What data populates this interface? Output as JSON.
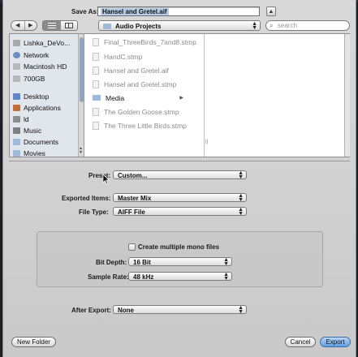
{
  "save_as": {
    "label": "Save As:",
    "value": "Hansel and Gretel.aif"
  },
  "location": {
    "current": "Audio Projects"
  },
  "search": {
    "placeholder": "search"
  },
  "sidebar": {
    "items": [
      {
        "label": "Lishka_DeVo...",
        "icon": "disk-icon"
      },
      {
        "label": "Network",
        "icon": "globe-icon"
      },
      {
        "label": "Macintosh HD",
        "icon": "hard-drive-icon"
      },
      {
        "label": "700GB",
        "icon": "hard-drive-icon"
      },
      {
        "label": "Desktop",
        "icon": "desktop-icon"
      },
      {
        "label": "Applications",
        "icon": "applications-icon"
      },
      {
        "label": "ld",
        "icon": "home-icon"
      },
      {
        "label": "Music",
        "icon": "music-icon"
      },
      {
        "label": "Documents",
        "icon": "documents-folder-icon"
      },
      {
        "label": "Movies",
        "icon": "movies-folder-icon"
      }
    ]
  },
  "files": [
    {
      "name": "Final_ThreeBirds_7and8.stmp",
      "kind": "file"
    },
    {
      "name": "HandC.stmp",
      "kind": "file"
    },
    {
      "name": "Hansel and Gretel.aif",
      "kind": "file"
    },
    {
      "name": "Hansel and Gretel.stmp",
      "kind": "file"
    },
    {
      "name": "Media",
      "kind": "folder"
    },
    {
      "name": "The Golden Goose.stmp",
      "kind": "file"
    },
    {
      "name": "The Three Little Birds.stmp",
      "kind": "file"
    }
  ],
  "options": {
    "preset_label": "Preset:",
    "preset_value": "Custom...",
    "exported_items_label": "Exported Items:",
    "exported_items_value": "Master Mix",
    "file_type_label": "File Type:",
    "file_type_value": "AIFF File",
    "mono_label": "Create multiple mono files",
    "bit_depth_label": "Bit Depth:",
    "bit_depth_value": "16 Bit",
    "sample_rate_label": "Sample Rate:",
    "sample_rate_value": "48 kHz",
    "after_export_label": "After Export:",
    "after_export_value": "None"
  },
  "buttons": {
    "new_folder": "New Folder",
    "cancel": "Cancel",
    "export": "Export"
  },
  "colors": {
    "accent": "#5f9ee0",
    "selection": "#b5cde6"
  }
}
